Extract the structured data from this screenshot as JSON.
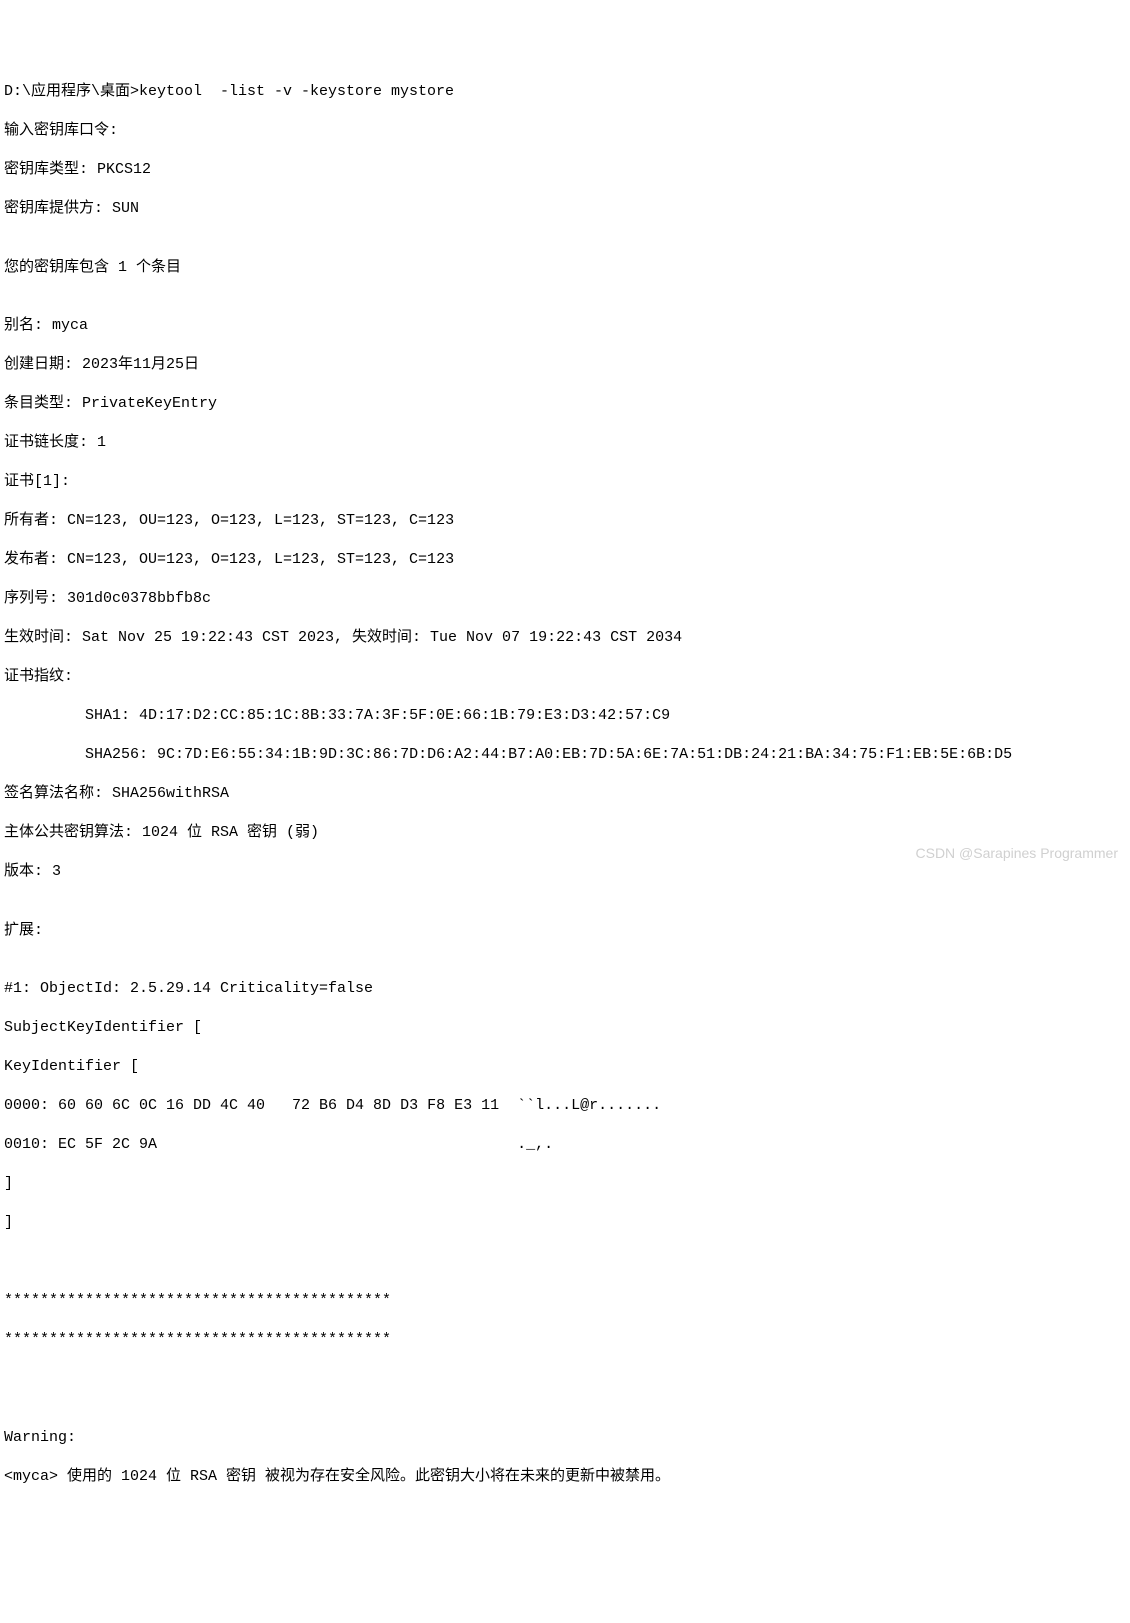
{
  "terminal": {
    "prompt_line": "D:\\应用程序\\桌面>keytool  -list -v -keystore mystore",
    "password_prompt": "输入密钥库口令:",
    "keystore_type": "密钥库类型: PKCS12",
    "keystore_provider": "密钥库提供方: SUN",
    "blank1": "",
    "entry_count": "您的密钥库包含 1 个条目",
    "blank2": "",
    "alias": "别名: myca",
    "creation_date": "创建日期: 2023年11月25日",
    "entry_type": "条目类型: PrivateKeyEntry",
    "chain_length": "证书链长度: 1",
    "cert_index": "证书[1]:",
    "owner": "所有者: CN=123, OU=123, O=123, L=123, ST=123, C=123",
    "issuer": "发布者: CN=123, OU=123, O=123, L=123, ST=123, C=123",
    "serial": "序列号: 301d0c0378bbfb8c",
    "validity": "生效时间: Sat Nov 25 19:22:43 CST 2023, 失效时间: Tue Nov 07 19:22:43 CST 2034",
    "fingerprints_label": "证书指纹:",
    "sha1": "         SHA1: 4D:17:D2:CC:85:1C:8B:33:7A:3F:5F:0E:66:1B:79:E3:D3:42:57:C9",
    "sha256": "         SHA256: 9C:7D:E6:55:34:1B:9D:3C:86:7D:D6:A2:44:B7:A0:EB:7D:5A:6E:7A:51:DB:24:21:BA:34:75:F1:EB:5E:6B:D5",
    "sig_alg": "签名算法名称: SHA256withRSA",
    "pubkey_alg": "主体公共密钥算法: 1024 位 RSA 密钥 (弱)",
    "version": "版本: 3",
    "blank3": "",
    "extensions_label": "扩展:",
    "blank4": "",
    "ext1_header": "#1: ObjectId: 2.5.29.14 Criticality=false",
    "ski_open": "SubjectKeyIdentifier [",
    "kid_open": "KeyIdentifier [",
    "hex_line1": "0000: 60 60 6C 0C 16 DD 4C 40   72 B6 D4 8D D3 F8 E3 11  ``l...L@r.......",
    "hex_line2": "0010: EC 5F 2C 9A                                        ._,.",
    "bracket_close1": "]",
    "bracket_close2": "]",
    "blank5": "",
    "blank6": "",
    "sep1": "*******************************************",
    "sep2": "*******************************************",
    "blank7": "",
    "blank8": "",
    "blank9": "",
    "warning_label": "Warning:",
    "warning_text": "<myca> 使用的 1024 位 RSA 密钥 被视为存在安全风险。此密钥大小将在未来的更新中被禁用。"
  },
  "watermark": "CSDN @Sarapines Programmer"
}
